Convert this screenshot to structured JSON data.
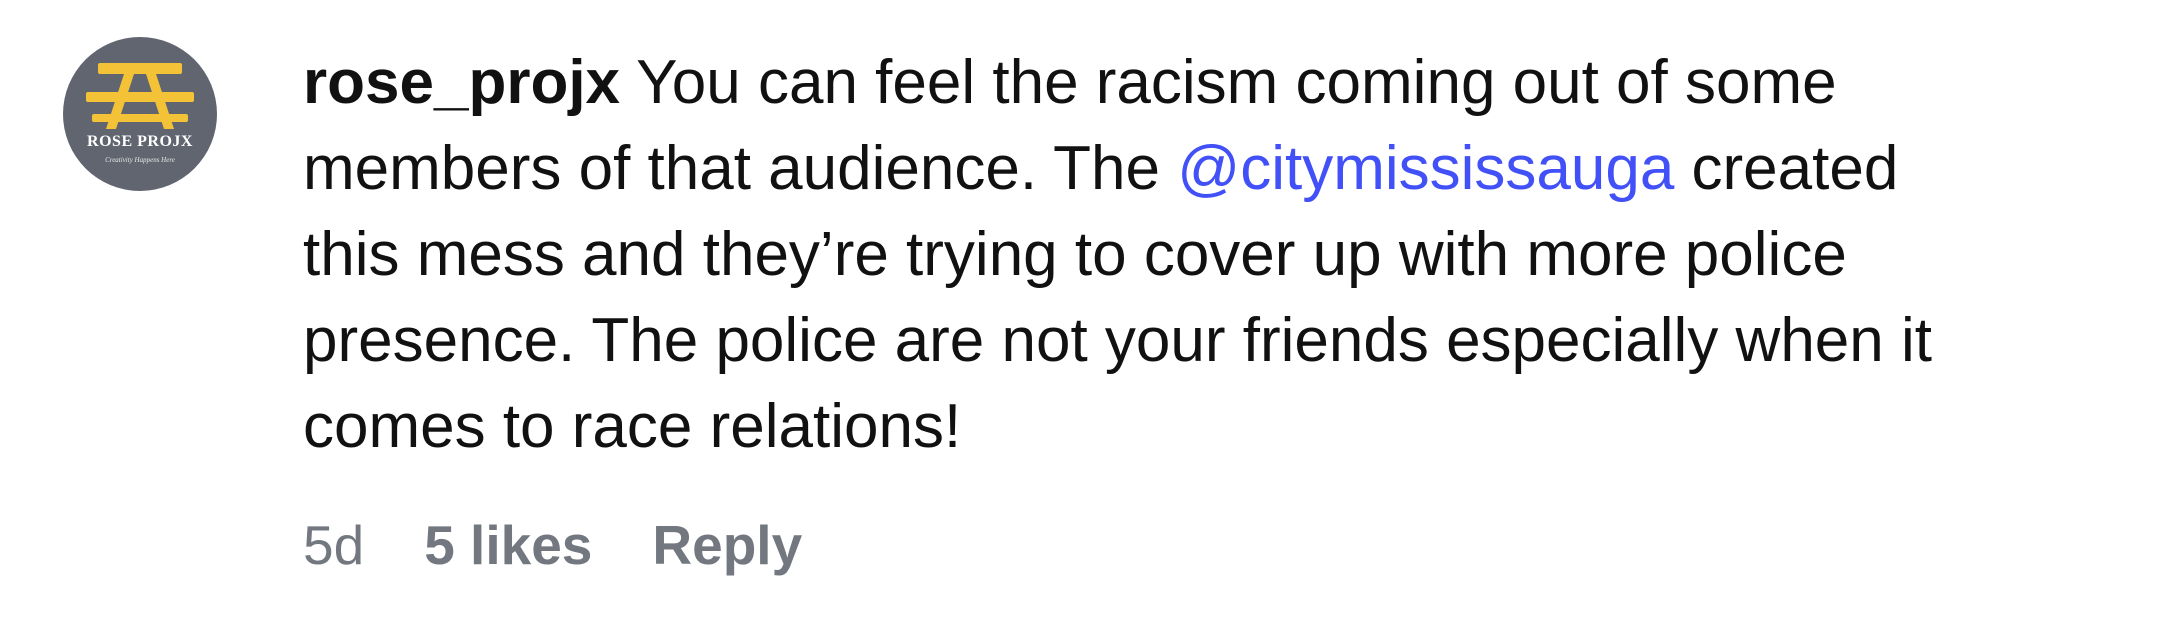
{
  "comment": {
    "avatar": {
      "brand_name": "ROSE PROJX",
      "tagline": "Creativity Happens Here",
      "icon": "picnic-table-logo-icon",
      "icon_color": "#f4c237",
      "background_color": "#616570"
    },
    "username": "rose_projx",
    "text_lines": [
      "You can feel the racism coming out of some",
      "members of that audience. The ",
      "@citymississauga",
      " created",
      "this mess and they’re trying to cover up with more police",
      "presence. The police are not your friends especially when it",
      "comes to race relations!"
    ],
    "mention_color": "#4150f7",
    "meta": {
      "age": "5d",
      "likes": "5 likes",
      "reply": "Reply"
    }
  }
}
